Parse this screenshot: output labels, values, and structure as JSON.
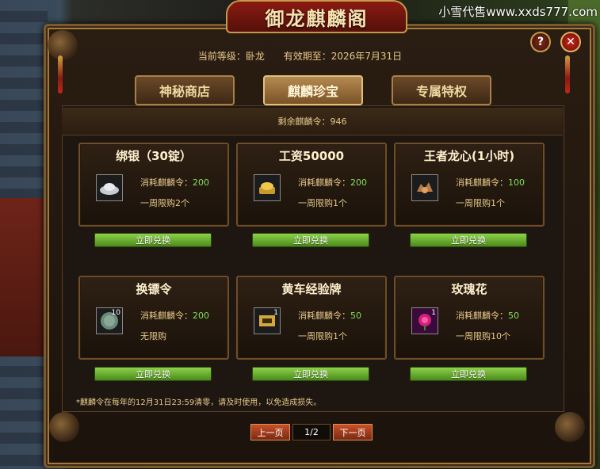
{
  "watermark": "小雪代售www.xxds777.com",
  "window": {
    "title": "御龙麒麟阁",
    "help_label": "?",
    "close_label": "✕"
  },
  "header": {
    "level_label": "当前等级：卧龙",
    "expiry_label": "有效期至：2026年7月31日"
  },
  "tabs": [
    {
      "label": "神秘商店",
      "active": false
    },
    {
      "label": "麒麟珍宝",
      "active": true
    },
    {
      "label": "专属特权",
      "active": false
    }
  ],
  "remaining": "剩余麒麟令：946",
  "cost_prefix": "消耗麒麟令：",
  "items": [
    {
      "name": "绑银（30锭）",
      "cost": "200",
      "limit": "一周限购2个",
      "icon": "silver-ingot-icon",
      "badge": "",
      "button": "立即兑换"
    },
    {
      "name": "工资50000",
      "cost": "200",
      "limit": "一周限购1个",
      "icon": "gold-ingot-icon",
      "badge": "",
      "button": "立即兑换"
    },
    {
      "name": "王者龙心(1小时)",
      "cost": "100",
      "limit": "一周限购1个",
      "icon": "dragon-heart-icon",
      "badge": "",
      "button": "立即兑换"
    },
    {
      "name": "换镖令",
      "cost": "200",
      "limit": "无限购",
      "icon": "escort-token-icon",
      "badge": "10",
      "button": "立即兑换"
    },
    {
      "name": "黄车经验牌",
      "cost": "50",
      "limit": "一周限购1个",
      "icon": "exp-plate-icon",
      "badge": "1",
      "button": "立即兑换"
    },
    {
      "name": "玫瑰花",
      "cost": "50",
      "limit": "一周限购10个",
      "icon": "rose-icon",
      "badge": "1",
      "button": "立即兑换"
    }
  ],
  "footnote": "*麒麟令在每年的12月31日23:59清零，请及时使用，以免造成损失。",
  "pager": {
    "prev": "上一页",
    "page": "1/2",
    "next": "下一页"
  },
  "colors": {
    "accent": "#e8c98a",
    "cost_value": "#7fe05a",
    "button_green": "#6eb436",
    "title_red": "#8a1a12"
  }
}
